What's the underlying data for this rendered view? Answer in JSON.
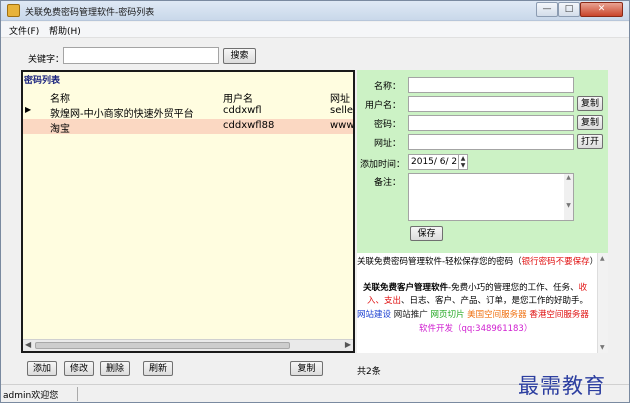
{
  "window": {
    "title": "关联免费密码管理软件-密码列表",
    "min": "—",
    "max": "□",
    "close": "✕"
  },
  "menu": {
    "file": "文件(F)",
    "help": "帮助(H)"
  },
  "search": {
    "label": "关键字：",
    "value": "",
    "button": "搜索"
  },
  "list": {
    "title": "密码列表",
    "columns": [
      "名称",
      "用户名",
      "网址"
    ],
    "rows": [
      {
        "name": "敦煌网-中小商家的快速外贸平台",
        "user": "cddxwfl",
        "url": "seller."
      },
      {
        "name": "淘宝",
        "user": "cddxwfl88",
        "url": "www.t"
      }
    ]
  },
  "form": {
    "name_label": "名称：",
    "user_label": "用户名：",
    "password_label": "密码：",
    "url_label": "网址：",
    "date_label": "添加时间：",
    "date_value": "2015/ 6/ 2",
    "memo_label": "备注：",
    "copy_user": "复制",
    "copy_password": "复制",
    "open_url": "打开",
    "save": "保存"
  },
  "ad": {
    "line1_black": "关联免费密码管理软件-轻松保存您的密码（",
    "line1_red": "银行密码不要保存",
    "line1_end": "）",
    "line2_bold": "关联免费客户管理软件",
    "line2_rest": "-免费小巧的管理您的工作、任务、",
    "line2_red": "收",
    "line3_red": "入、支出",
    "line3_rest": "、日志、客户、产品、订单，是您工作的好助手。",
    "link_site": "网站建设",
    "link_promo": "网站推广",
    "link_slice": "网页切片",
    "link_us": "美国空间服务器",
    "link_hk": "香港空间服务器",
    "link_dev": "软件开发（qq:348961183）",
    "colors": {
      "red": "#e01010",
      "blue": "#1a3fd0",
      "green": "#23a823",
      "orange": "#f07010",
      "magenta": "#d020d0"
    }
  },
  "buttons": {
    "add": "添加",
    "edit": "修改",
    "delete": "删除",
    "refresh": "刷新",
    "copy": "复制"
  },
  "count": "共2条",
  "status": "admin欢迎您",
  "watermark": "最需教育"
}
